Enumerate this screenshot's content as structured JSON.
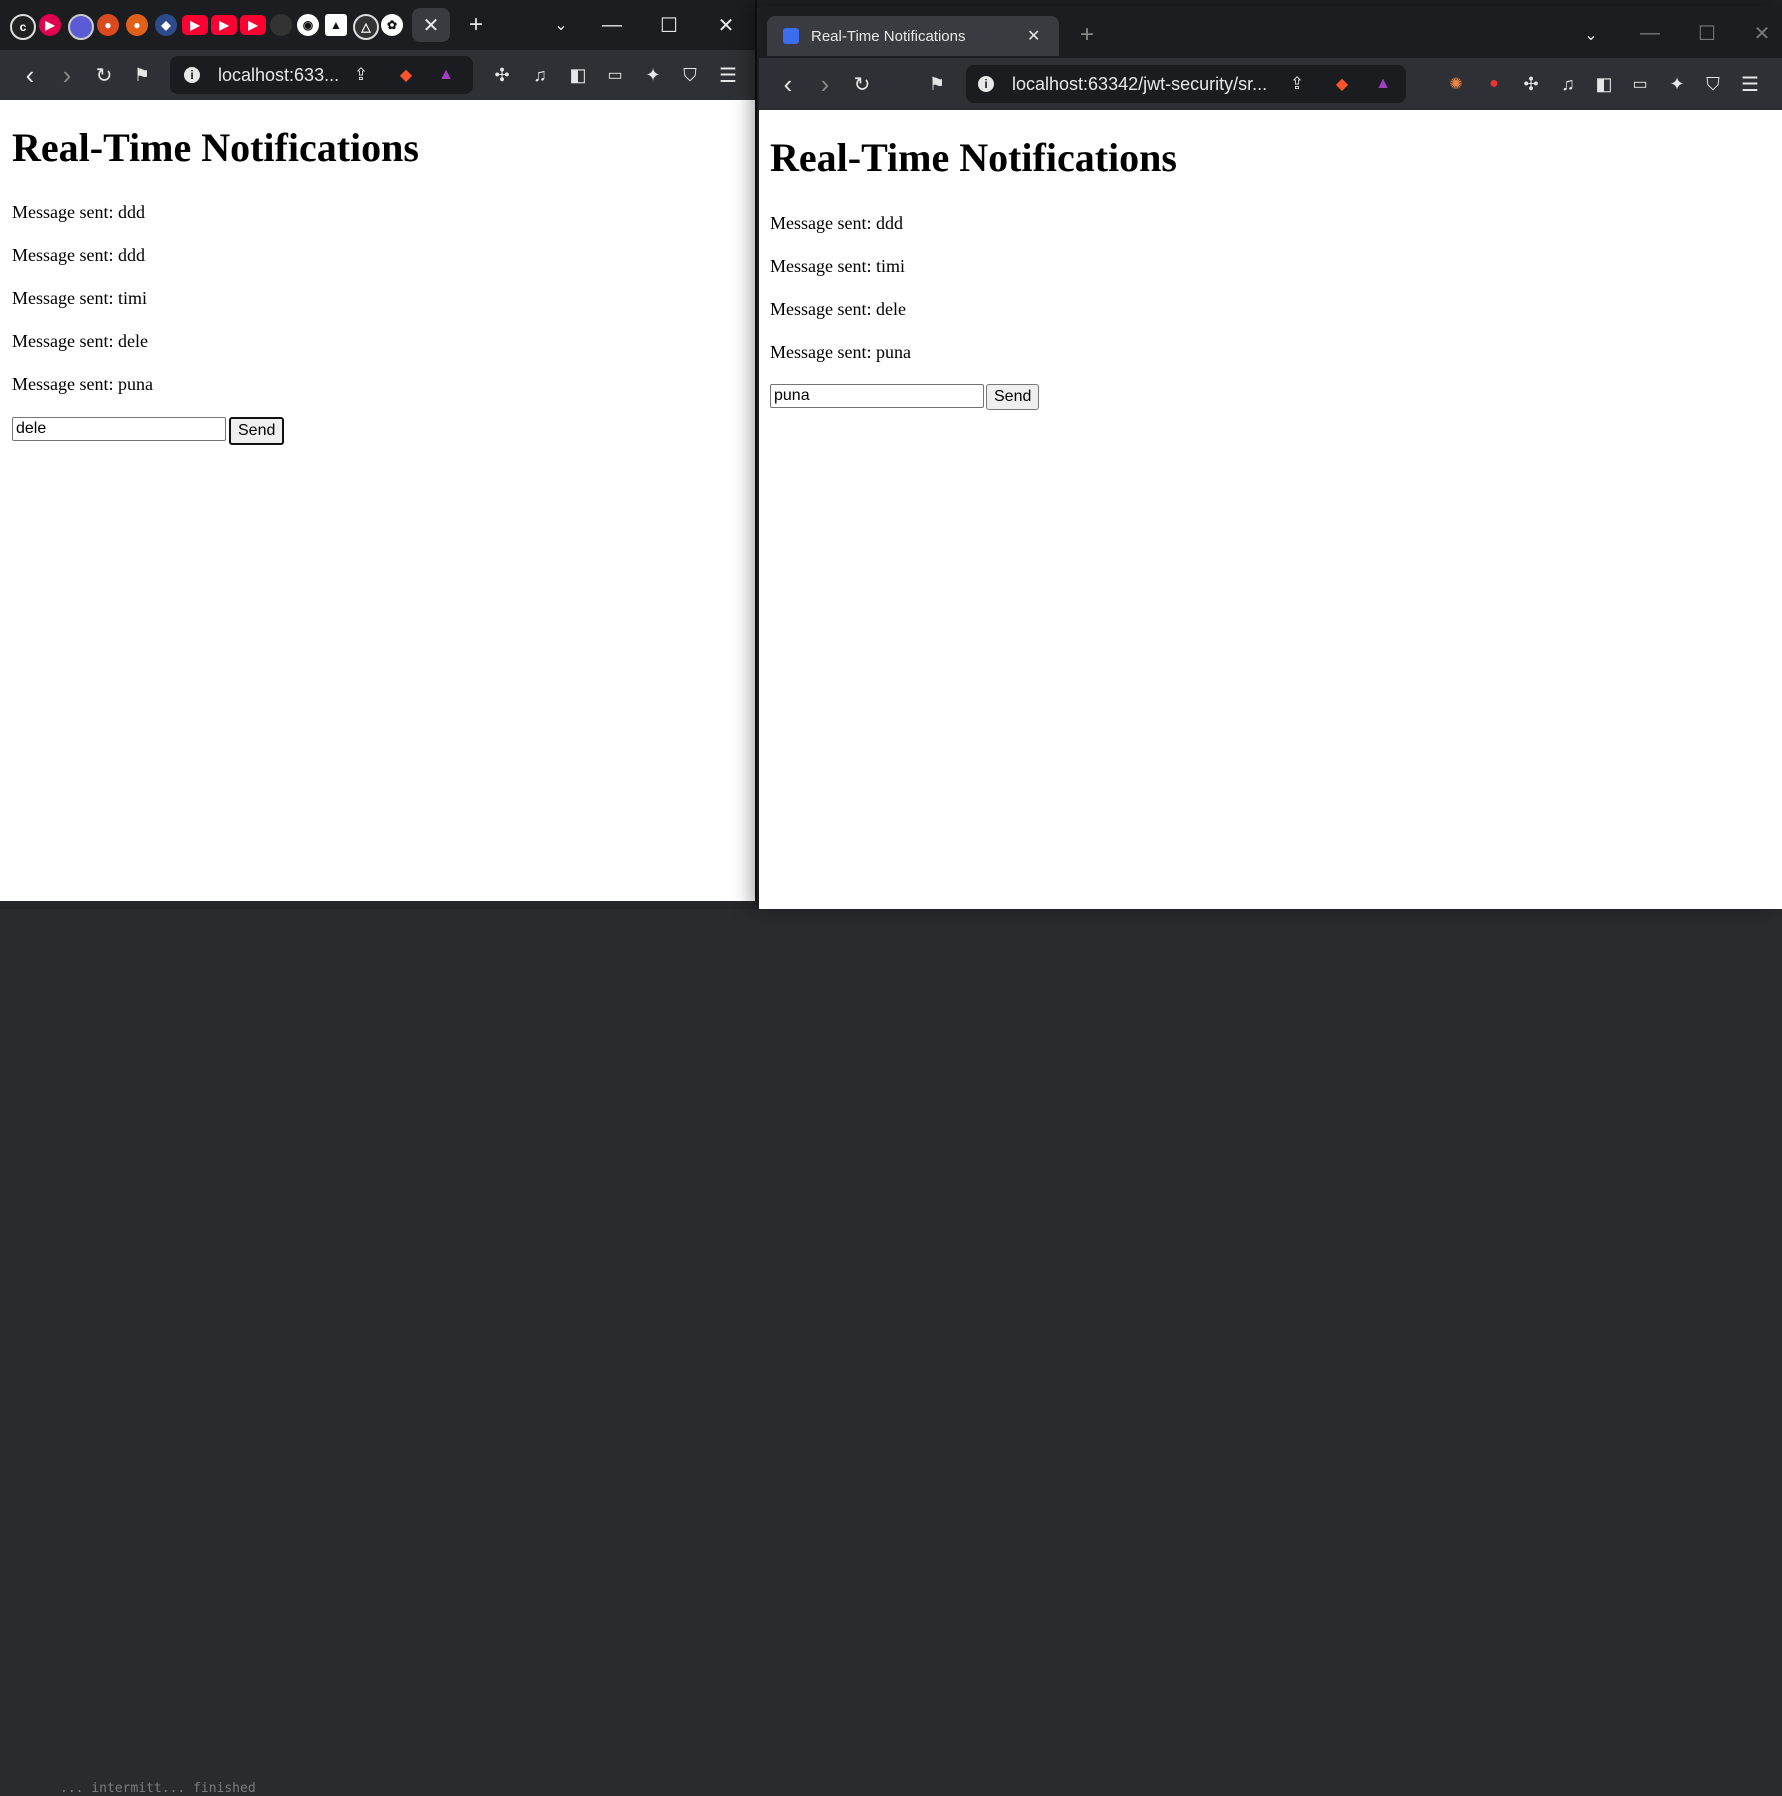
{
  "colors": {
    "chrome_dark": "#1c1d21",
    "toolbar": "#2f3035",
    "brave_orange": "#fb542b",
    "youtube_red": "#ff0033"
  },
  "left_window": {
    "pinned_tabs": [
      "c-icon",
      "youtube-icon",
      "circle-icon",
      "fire-icon",
      "fire-icon",
      "shield-icon",
      "youtube-icon",
      "youtube-icon",
      "youtube-icon",
      "github-dark-icon",
      "github-icon",
      "mountain-icon",
      "triangle-icon",
      "openai-icon"
    ],
    "url": "localhost:633...",
    "page": {
      "heading": "Real-Time Notifications",
      "messages": [
        "Message sent: ddd",
        "Message sent: ddd",
        "Message sent: timi",
        "Message sent: dele",
        "Message sent: puna"
      ],
      "input_value": "dele",
      "send_label": "Send"
    }
  },
  "right_window": {
    "tab_title": "Real-Time Notifications",
    "url": "localhost:63342/jwt-security/sr...",
    "page": {
      "heading": "Real-Time Notifications",
      "messages": [
        "Message sent: ddd",
        "Message sent: timi",
        "Message sent: dele",
        "Message sent: puna"
      ],
      "input_value": "puna",
      "send_label": "Send"
    }
  },
  "background_text": "... intermitt... finished"
}
